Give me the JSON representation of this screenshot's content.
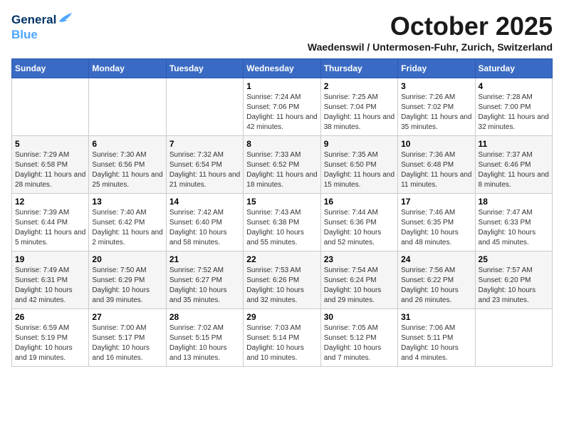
{
  "header": {
    "logo_general": "General",
    "logo_blue": "Blue",
    "month": "October 2025",
    "location": "Waedenswil / Untermosen-Fuhr, Zurich, Switzerland"
  },
  "weekdays": [
    "Sunday",
    "Monday",
    "Tuesday",
    "Wednesday",
    "Thursday",
    "Friday",
    "Saturday"
  ],
  "weeks": [
    [
      {
        "day": "",
        "sunrise": "",
        "sunset": "",
        "daylight": ""
      },
      {
        "day": "",
        "sunrise": "",
        "sunset": "",
        "daylight": ""
      },
      {
        "day": "",
        "sunrise": "",
        "sunset": "",
        "daylight": ""
      },
      {
        "day": "1",
        "sunrise": "Sunrise: 7:24 AM",
        "sunset": "Sunset: 7:06 PM",
        "daylight": "Daylight: 11 hours and 42 minutes."
      },
      {
        "day": "2",
        "sunrise": "Sunrise: 7:25 AM",
        "sunset": "Sunset: 7:04 PM",
        "daylight": "Daylight: 11 hours and 38 minutes."
      },
      {
        "day": "3",
        "sunrise": "Sunrise: 7:26 AM",
        "sunset": "Sunset: 7:02 PM",
        "daylight": "Daylight: 11 hours and 35 minutes."
      },
      {
        "day": "4",
        "sunrise": "Sunrise: 7:28 AM",
        "sunset": "Sunset: 7:00 PM",
        "daylight": "Daylight: 11 hours and 32 minutes."
      }
    ],
    [
      {
        "day": "5",
        "sunrise": "Sunrise: 7:29 AM",
        "sunset": "Sunset: 6:58 PM",
        "daylight": "Daylight: 11 hours and 28 minutes."
      },
      {
        "day": "6",
        "sunrise": "Sunrise: 7:30 AM",
        "sunset": "Sunset: 6:56 PM",
        "daylight": "Daylight: 11 hours and 25 minutes."
      },
      {
        "day": "7",
        "sunrise": "Sunrise: 7:32 AM",
        "sunset": "Sunset: 6:54 PM",
        "daylight": "Daylight: 11 hours and 21 minutes."
      },
      {
        "day": "8",
        "sunrise": "Sunrise: 7:33 AM",
        "sunset": "Sunset: 6:52 PM",
        "daylight": "Daylight: 11 hours and 18 minutes."
      },
      {
        "day": "9",
        "sunrise": "Sunrise: 7:35 AM",
        "sunset": "Sunset: 6:50 PM",
        "daylight": "Daylight: 11 hours and 15 minutes."
      },
      {
        "day": "10",
        "sunrise": "Sunrise: 7:36 AM",
        "sunset": "Sunset: 6:48 PM",
        "daylight": "Daylight: 11 hours and 11 minutes."
      },
      {
        "day": "11",
        "sunrise": "Sunrise: 7:37 AM",
        "sunset": "Sunset: 6:46 PM",
        "daylight": "Daylight: 11 hours and 8 minutes."
      }
    ],
    [
      {
        "day": "12",
        "sunrise": "Sunrise: 7:39 AM",
        "sunset": "Sunset: 6:44 PM",
        "daylight": "Daylight: 11 hours and 5 minutes."
      },
      {
        "day": "13",
        "sunrise": "Sunrise: 7:40 AM",
        "sunset": "Sunset: 6:42 PM",
        "daylight": "Daylight: 11 hours and 2 minutes."
      },
      {
        "day": "14",
        "sunrise": "Sunrise: 7:42 AM",
        "sunset": "Sunset: 6:40 PM",
        "daylight": "Daylight: 10 hours and 58 minutes."
      },
      {
        "day": "15",
        "sunrise": "Sunrise: 7:43 AM",
        "sunset": "Sunset: 6:38 PM",
        "daylight": "Daylight: 10 hours and 55 minutes."
      },
      {
        "day": "16",
        "sunrise": "Sunrise: 7:44 AM",
        "sunset": "Sunset: 6:36 PM",
        "daylight": "Daylight: 10 hours and 52 minutes."
      },
      {
        "day": "17",
        "sunrise": "Sunrise: 7:46 AM",
        "sunset": "Sunset: 6:35 PM",
        "daylight": "Daylight: 10 hours and 48 minutes."
      },
      {
        "day": "18",
        "sunrise": "Sunrise: 7:47 AM",
        "sunset": "Sunset: 6:33 PM",
        "daylight": "Daylight: 10 hours and 45 minutes."
      }
    ],
    [
      {
        "day": "19",
        "sunrise": "Sunrise: 7:49 AM",
        "sunset": "Sunset: 6:31 PM",
        "daylight": "Daylight: 10 hours and 42 minutes."
      },
      {
        "day": "20",
        "sunrise": "Sunrise: 7:50 AM",
        "sunset": "Sunset: 6:29 PM",
        "daylight": "Daylight: 10 hours and 39 minutes."
      },
      {
        "day": "21",
        "sunrise": "Sunrise: 7:52 AM",
        "sunset": "Sunset: 6:27 PM",
        "daylight": "Daylight: 10 hours and 35 minutes."
      },
      {
        "day": "22",
        "sunrise": "Sunrise: 7:53 AM",
        "sunset": "Sunset: 6:26 PM",
        "daylight": "Daylight: 10 hours and 32 minutes."
      },
      {
        "day": "23",
        "sunrise": "Sunrise: 7:54 AM",
        "sunset": "Sunset: 6:24 PM",
        "daylight": "Daylight: 10 hours and 29 minutes."
      },
      {
        "day": "24",
        "sunrise": "Sunrise: 7:56 AM",
        "sunset": "Sunset: 6:22 PM",
        "daylight": "Daylight: 10 hours and 26 minutes."
      },
      {
        "day": "25",
        "sunrise": "Sunrise: 7:57 AM",
        "sunset": "Sunset: 6:20 PM",
        "daylight": "Daylight: 10 hours and 23 minutes."
      }
    ],
    [
      {
        "day": "26",
        "sunrise": "Sunrise: 6:59 AM",
        "sunset": "Sunset: 5:19 PM",
        "daylight": "Daylight: 10 hours and 19 minutes."
      },
      {
        "day": "27",
        "sunrise": "Sunrise: 7:00 AM",
        "sunset": "Sunset: 5:17 PM",
        "daylight": "Daylight: 10 hours and 16 minutes."
      },
      {
        "day": "28",
        "sunrise": "Sunrise: 7:02 AM",
        "sunset": "Sunset: 5:15 PM",
        "daylight": "Daylight: 10 hours and 13 minutes."
      },
      {
        "day": "29",
        "sunrise": "Sunrise: 7:03 AM",
        "sunset": "Sunset: 5:14 PM",
        "daylight": "Daylight: 10 hours and 10 minutes."
      },
      {
        "day": "30",
        "sunrise": "Sunrise: 7:05 AM",
        "sunset": "Sunset: 5:12 PM",
        "daylight": "Daylight: 10 hours and 7 minutes."
      },
      {
        "day": "31",
        "sunrise": "Sunrise: 7:06 AM",
        "sunset": "Sunset: 5:11 PM",
        "daylight": "Daylight: 10 hours and 4 minutes."
      },
      {
        "day": "",
        "sunrise": "",
        "sunset": "",
        "daylight": ""
      }
    ]
  ]
}
